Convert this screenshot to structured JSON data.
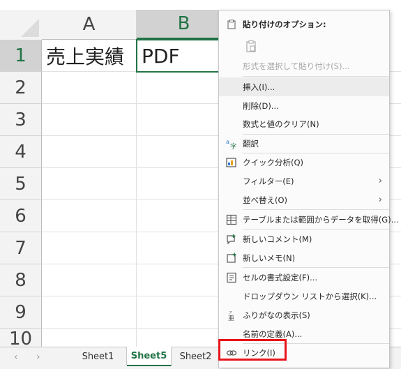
{
  "sheet": {
    "columns": [
      {
        "label": "A",
        "selected": false
      },
      {
        "label": "B",
        "selected": true
      }
    ],
    "rows": [
      "1",
      "2",
      "3",
      "4",
      "5",
      "6",
      "7",
      "8",
      "9",
      "10"
    ],
    "cells": {
      "A1": "売上実績",
      "B1": "PDF"
    },
    "active_cell": "B1"
  },
  "tabs": {
    "nav_prev": "‹",
    "nav_next": "›",
    "items": [
      {
        "label": "Sheet1",
        "active": false
      },
      {
        "label": "Sheet5",
        "active": true
      },
      {
        "label": "Sheet2",
        "active": false
      }
    ]
  },
  "menu": {
    "paste_header": "貼り付けのオプション:",
    "paste_special": "形式を選択して貼り付け(S)...",
    "items": [
      {
        "label": "挿入(I)...",
        "icon": "none"
      },
      {
        "label": "削除(D)...",
        "icon": "none"
      },
      {
        "label": "数式と値のクリア(N)",
        "icon": "none"
      },
      {
        "label": "翻訳",
        "icon": "translate-icon"
      },
      {
        "label": "クイック分析(Q)",
        "icon": "quick-analysis-icon"
      },
      {
        "label": "フィルター(E)",
        "icon": "none",
        "submenu": true
      },
      {
        "label": "並べ替え(O)",
        "icon": "none",
        "submenu": true
      },
      {
        "label": "テーブルまたは範囲からデータを取得(G)...",
        "icon": "table-icon"
      },
      {
        "label": "新しいコメント(M)",
        "icon": "new-comment-icon"
      },
      {
        "label": "新しいメモ(N)",
        "icon": "new-note-icon"
      },
      {
        "label": "セルの書式設定(F)...",
        "icon": "format-cells-icon"
      },
      {
        "label": "ドロップダウン リストから選択(K)...",
        "icon": "none"
      },
      {
        "label": "ふりがなの表示(S)",
        "icon": "furigana-icon"
      },
      {
        "label": "名前の定義(A)...",
        "icon": "none"
      },
      {
        "label": "リンク(I)",
        "icon": "link-icon"
      }
    ],
    "hovered_item": "挿入(I)...",
    "highlight_item": "リンク(I)"
  },
  "colors": {
    "excel_green": "#217346",
    "highlight_red": "#e8141b"
  }
}
